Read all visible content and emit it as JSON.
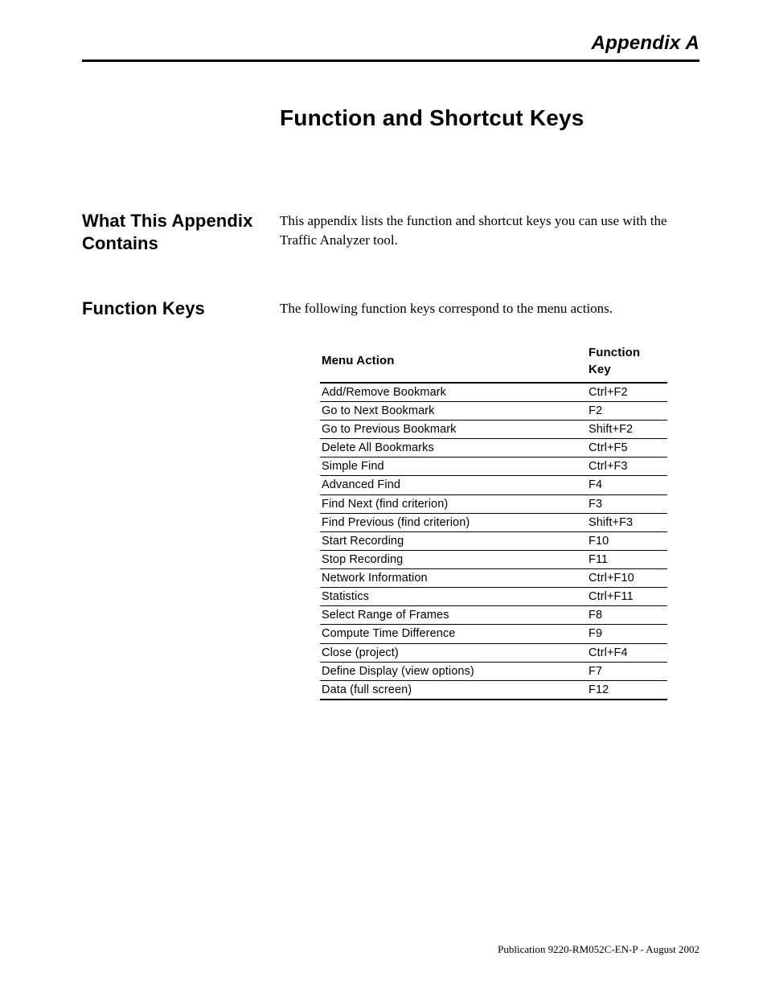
{
  "appendix_label": "Appendix A",
  "title": "Function and Shortcut Keys",
  "section_contains": {
    "heading": "What This Appendix Contains",
    "body": "This appendix lists the function and shortcut keys you can use with the Traffic Analyzer tool."
  },
  "section_function_keys": {
    "heading": "Function Keys",
    "intro": "The following function keys correspond to the menu actions.",
    "table": {
      "header_action": "Menu Action",
      "header_key": "Function Key",
      "rows": [
        {
          "action": "Add/Remove Bookmark",
          "key": "Ctrl+F2"
        },
        {
          "action": "Go to Next Bookmark",
          "key": "F2"
        },
        {
          "action": "Go to Previous Bookmark",
          "key": "Shift+F2"
        },
        {
          "action": "Delete All Bookmarks",
          "key": "Ctrl+F5"
        },
        {
          "action": "Simple Find",
          "key": "Ctrl+F3"
        },
        {
          "action": "Advanced Find",
          "key": "F4"
        },
        {
          "action": "Find Next (find criterion)",
          "key": "F3"
        },
        {
          "action": "Find Previous (find criterion)",
          "key": "Shift+F3"
        },
        {
          "action": "Start Recording",
          "key": "F10"
        },
        {
          "action": "Stop Recording",
          "key": "F11"
        },
        {
          "action": "Network Information",
          "key": "Ctrl+F10"
        },
        {
          "action": "Statistics",
          "key": "Ctrl+F11"
        },
        {
          "action": "Select Range of Frames",
          "key": "F8"
        },
        {
          "action": "Compute Time Difference",
          "key": "F9"
        },
        {
          "action": "Close (project)",
          "key": "Ctrl+F4"
        },
        {
          "action": "Define Display (view options)",
          "key": "F7"
        },
        {
          "action": "Data (full screen)",
          "key": "F12"
        }
      ]
    }
  },
  "footer": "Publication 9220-RM052C-EN-P - August 2002"
}
